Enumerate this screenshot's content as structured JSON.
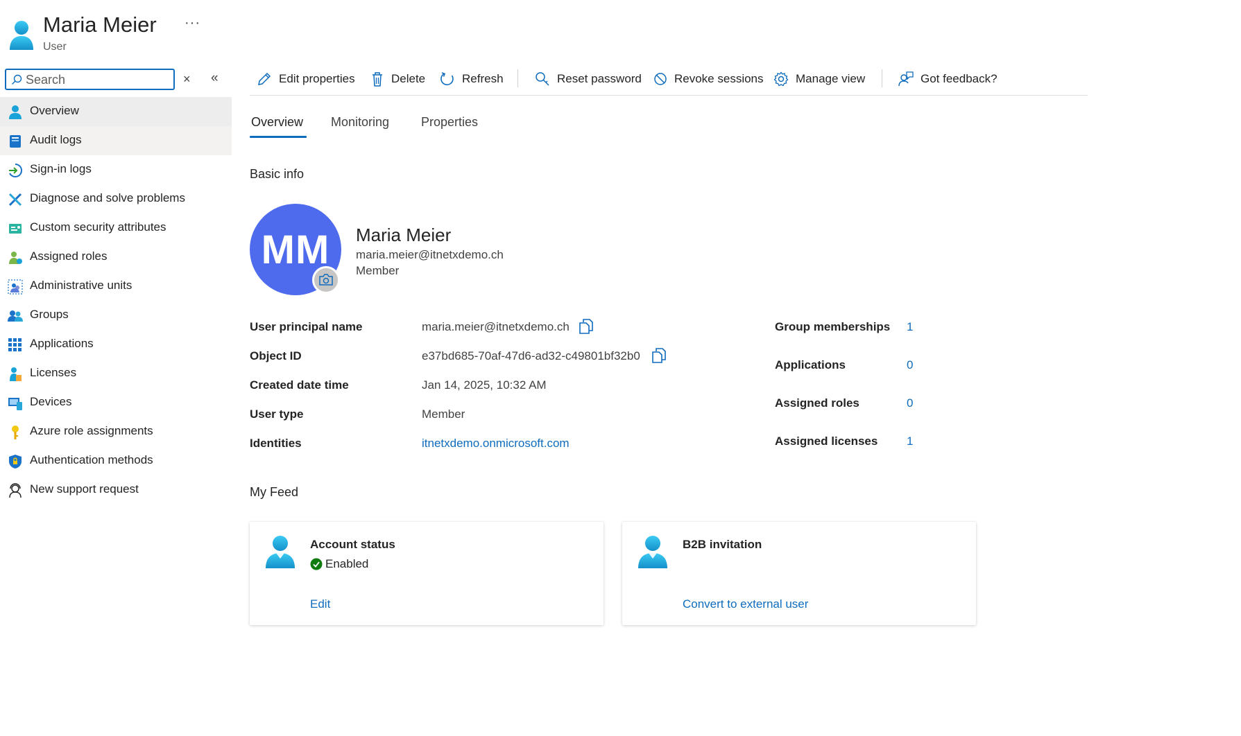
{
  "header": {
    "title": "Maria Meier",
    "subtitle": "User",
    "more_label": "···"
  },
  "search": {
    "placeholder": "Search",
    "value": "",
    "clear_label": "×",
    "collapse_label": "«"
  },
  "sidebar": {
    "items": [
      {
        "label": "Overview",
        "icon": "user-icon"
      },
      {
        "label": "Audit logs",
        "icon": "audit-log-icon"
      },
      {
        "label": "Sign-in logs",
        "icon": "sign-in-icon"
      },
      {
        "label": "Diagnose and solve problems",
        "icon": "wrench-icon"
      },
      {
        "label": "Custom security attributes",
        "icon": "attributes-icon"
      },
      {
        "label": "Assigned roles",
        "icon": "roles-icon"
      },
      {
        "label": "Administrative units",
        "icon": "admin-units-icon"
      },
      {
        "label": "Groups",
        "icon": "groups-icon"
      },
      {
        "label": "Applications",
        "icon": "apps-grid-icon"
      },
      {
        "label": "Licenses",
        "icon": "license-icon"
      },
      {
        "label": "Devices",
        "icon": "devices-icon"
      },
      {
        "label": "Azure role assignments",
        "icon": "key-icon"
      },
      {
        "label": "Authentication methods",
        "icon": "shield-icon"
      },
      {
        "label": "New support request",
        "icon": "support-icon"
      }
    ]
  },
  "toolbar": {
    "edit_label": "Edit properties",
    "delete_label": "Delete",
    "refresh_label": "Refresh",
    "reset_password_label": "Reset password",
    "revoke_sessions_label": "Revoke sessions",
    "manage_view_label": "Manage view",
    "feedback_label": "Got feedback?"
  },
  "tabs": [
    {
      "label": "Overview",
      "active": true
    },
    {
      "label": "Monitoring",
      "active": false
    },
    {
      "label": "Properties",
      "active": false
    }
  ],
  "basic_info": {
    "title": "Basic info",
    "initials": "MM",
    "name": "Maria Meier",
    "email": "maria.meier@itnetxdemo.ch",
    "type": "Member"
  },
  "properties": {
    "upn_label": "User principal name",
    "upn_value": "maria.meier@itnetxdemo.ch",
    "object_id_label": "Object ID",
    "object_id_value": "e37bd685-70af-47d6-ad32-c49801bf32b0",
    "created_label": "Created date time",
    "created_value": "Jan 14, 2025, 10:32 AM",
    "user_type_label": "User type",
    "user_type_value": "Member",
    "identities_label": "Identities",
    "identities_value": "itnetxdemo.onmicrosoft.com"
  },
  "stats": {
    "group_memberships_label": "Group memberships",
    "group_memberships_value": "1",
    "applications_label": "Applications",
    "applications_value": "0",
    "assigned_roles_label": "Assigned roles",
    "assigned_roles_value": "0",
    "assigned_licenses_label": "Assigned licenses",
    "assigned_licenses_value": "1"
  },
  "feed": {
    "title": "My Feed",
    "account_status": {
      "title": "Account status",
      "status": "Enabled",
      "link": "Edit"
    },
    "b2b_invitation": {
      "title": "B2B invitation",
      "link": "Convert to external user"
    }
  },
  "colors": {
    "accent": "#0f6cbd",
    "avatar_bg": "#4f6bed",
    "enabled_green": "#107c10",
    "user_icon_blue": "#1aa3d9"
  }
}
